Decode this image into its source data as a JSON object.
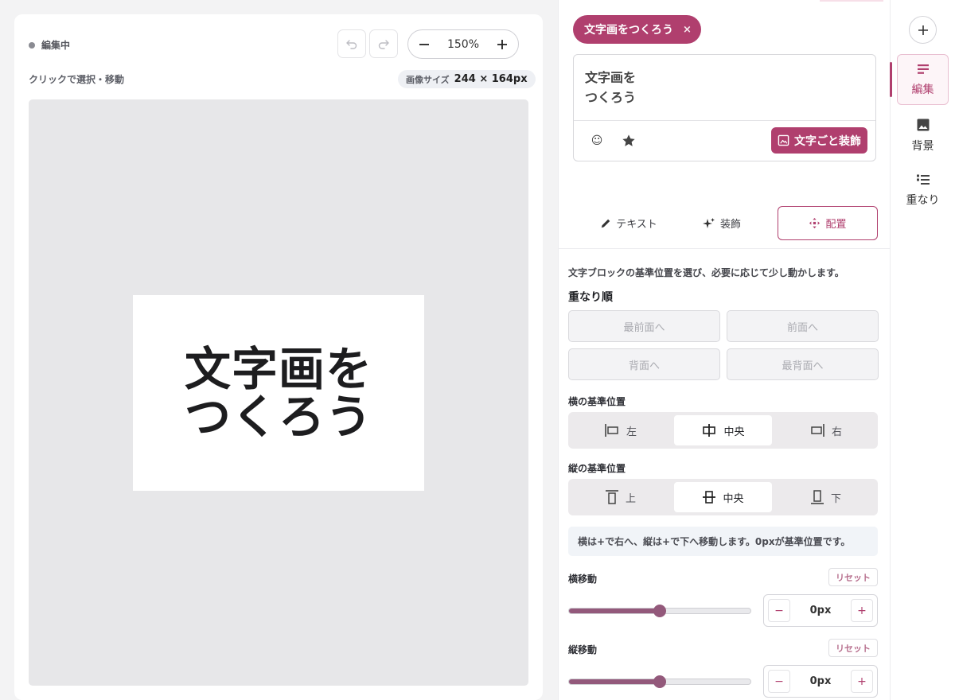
{
  "canvas": {
    "status_label": "編集中",
    "zoom_value": "150%",
    "hint": "クリックで選択・移動",
    "size_label": "画像サイズ",
    "size_value": "244 × 164px",
    "artwork_text_line1": "文字画を",
    "artwork_text_line2": "つくろう"
  },
  "editor": {
    "chip_label": "文字画をつくろう",
    "chip_close": "×",
    "text_line1": "文字画を",
    "text_line2": "つくろう",
    "emoji_icon": "☺",
    "decorate_label": "文字ごと装飾",
    "tabs": [
      {
        "label": "テキスト"
      },
      {
        "label": "装飾"
      },
      {
        "label": "配置"
      }
    ],
    "description": "文字ブロックの基準位置を選び、必要に応じて少し動かします。",
    "order_title": "重なり順",
    "order_buttons": [
      "最前面へ",
      "前面へ",
      "背面へ",
      "最背面へ"
    ],
    "horizontal_title": "横の基準位置",
    "horizontal_options": [
      "左",
      "中央",
      "右"
    ],
    "horizontal_selected": "中央",
    "vertical_title": "縦の基準位置",
    "vertical_options": [
      "上",
      "中央",
      "下"
    ],
    "vertical_selected": "中央",
    "info_text": "横は+で右へ、縦は+で下へ移動します。0pxが基準位置です。",
    "h_move_title": "横移動",
    "v_move_title": "縦移動",
    "reset_label": "リセット",
    "h_move_value": "0px",
    "v_move_value": "0px",
    "h_slider_fraction": 0.5,
    "v_slider_fraction": 0.5,
    "minus": "−",
    "plus": "+"
  },
  "nav": {
    "items": [
      {
        "label": "編集"
      },
      {
        "label": "背景"
      },
      {
        "label": "重なり"
      }
    ]
  },
  "colors": {
    "accent": "#b03f6e",
    "slider": "#93597b"
  }
}
